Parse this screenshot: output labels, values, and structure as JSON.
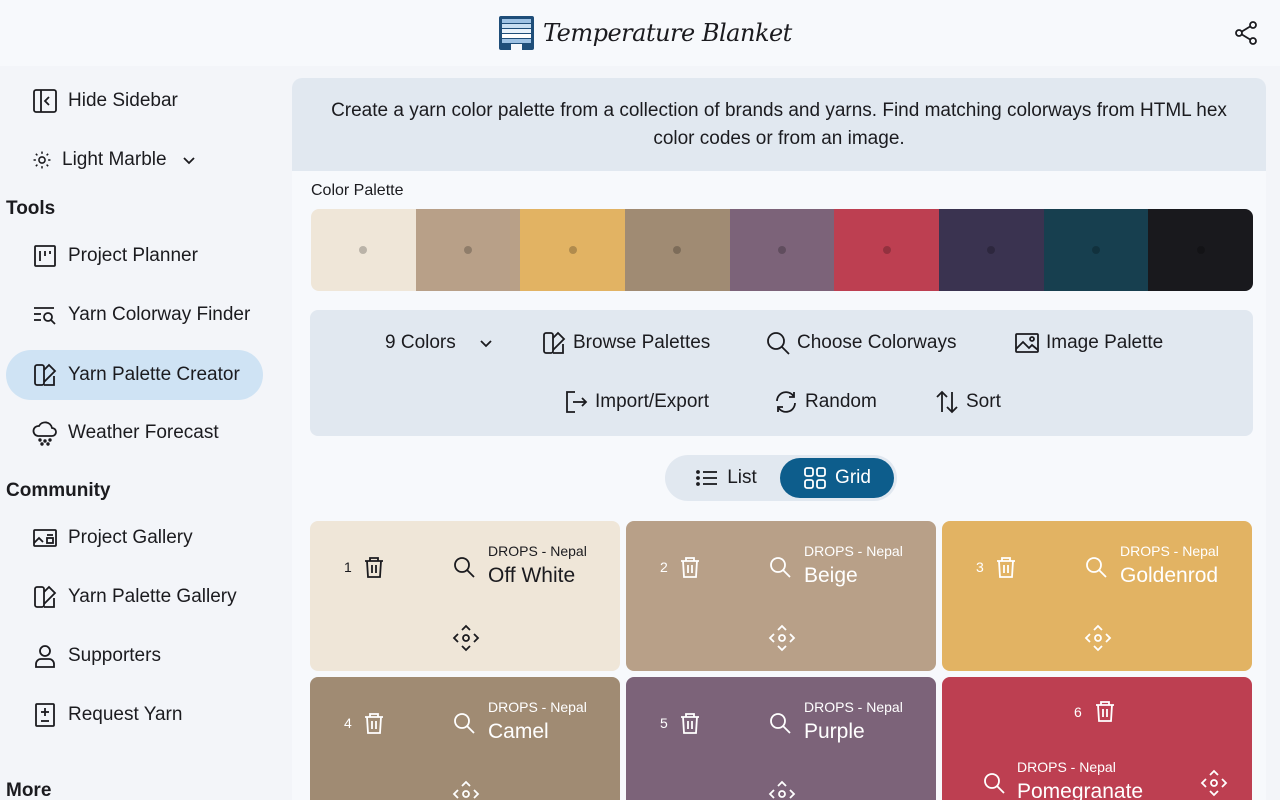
{
  "app": {
    "title": "Temperature Blanket"
  },
  "sidebar": {
    "hide": "Hide Sidebar",
    "theme": "Light Marble",
    "tools_heading": "Tools",
    "tools": [
      {
        "label": "Project Planner"
      },
      {
        "label": "Yarn Colorway Finder"
      },
      {
        "label": "Yarn Palette Creator",
        "active": true
      },
      {
        "label": "Weather Forecast"
      }
    ],
    "community_heading": "Community",
    "community": [
      {
        "label": "Project Gallery"
      },
      {
        "label": "Yarn Palette Gallery"
      },
      {
        "label": "Supporters"
      },
      {
        "label": "Request Yarn"
      }
    ],
    "more_heading": "More"
  },
  "main": {
    "intro": "Create a yarn color palette from a collection of brands and yarns. Find matching colorways from HTML hex color codes or from an image.",
    "palette_label": "Color Palette",
    "palette": [
      {
        "hex": "#efe6d8"
      },
      {
        "hex": "#b8a088"
      },
      {
        "hex": "#e2b363"
      },
      {
        "hex": "#a08b73"
      },
      {
        "hex": "#7c6379"
      },
      {
        "hex": "#bd3f51"
      },
      {
        "hex": "#3a3350"
      },
      {
        "hex": "#173f4f"
      },
      {
        "hex": "#19191d"
      }
    ],
    "toolbar": {
      "colors": "9 Colors",
      "browse": "Browse Palettes",
      "choose": "Choose Colorways",
      "image": "Image Palette",
      "import_export": "Import/Export",
      "random": "Random",
      "sort": "Sort"
    },
    "view_toggle": {
      "list": "List",
      "grid": "Grid",
      "selected": "Grid"
    },
    "cards": [
      {
        "num": "1",
        "brand": "DROPS - Nepal",
        "name": "Off White",
        "bg": "#efe6d8",
        "fg": "#1b1b1f"
      },
      {
        "num": "2",
        "brand": "DROPS - Nepal",
        "name": "Beige",
        "bg": "#b8a088",
        "fg": "#ffffff"
      },
      {
        "num": "3",
        "brand": "DROPS - Nepal",
        "name": "Goldenrod",
        "bg": "#e2b363",
        "fg": "#ffffff"
      },
      {
        "num": "4",
        "brand": "DROPS - Nepal",
        "name": "Camel",
        "bg": "#a08b73",
        "fg": "#ffffff"
      },
      {
        "num": "5",
        "brand": "DROPS - Nepal",
        "name": "Purple",
        "bg": "#7c6379",
        "fg": "#ffffff"
      },
      {
        "num": "6",
        "brand": "DROPS - Nepal",
        "name": "Pomegranate",
        "bg": "#bd3f51",
        "fg": "#ffffff"
      }
    ]
  }
}
